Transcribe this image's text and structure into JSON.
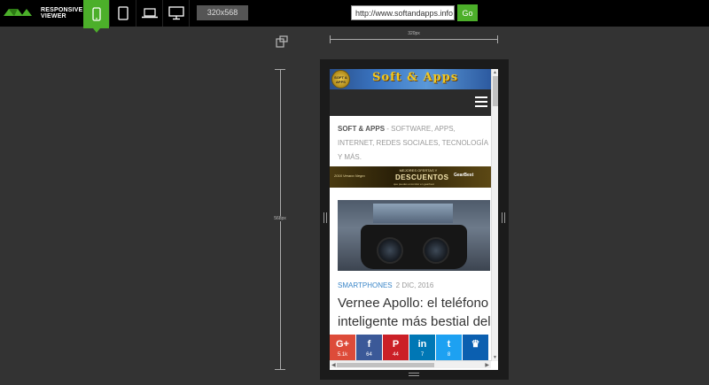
{
  "app": {
    "logo_text_line1": "RESPONSIVE",
    "logo_text_line2": "VIEWER",
    "accent_color": "#4caf2a"
  },
  "toolbar": {
    "devices": [
      {
        "name": "phone",
        "icon": "phone-icon",
        "active": true
      },
      {
        "name": "tablet",
        "icon": "tablet-icon",
        "active": false
      },
      {
        "name": "laptop",
        "icon": "laptop-icon",
        "active": false
      },
      {
        "name": "desktop",
        "icon": "desktop-icon",
        "active": false
      }
    ],
    "size_display": "320x568",
    "url_value": "http://www.softandapps.info",
    "go_label": "Go"
  },
  "rulers": {
    "width_label": "320px",
    "height_label": "568px"
  },
  "site": {
    "banner_logo_text": "SOFT & APPS",
    "banner_title": "Soft & Apps",
    "tagline_bold": "SOFT & APPS",
    "tagline_rest": " - SOFTWARE, APPS, INTERNET, REDES SOCIALES, TECNOLOGÍA Y MÁS.",
    "ad": {
      "left_text": "2016 Verano Negro",
      "title": "MEJORES OFERTAS Y",
      "big": "DESCUENTOS",
      "sub": "que puedes encontrar en gearbest",
      "right_text": "GearBest"
    },
    "article": {
      "category": "SMARTPHONES",
      "date": "2 DIC, 2016",
      "headline": "Vernee Apollo: el teléfono inteligente más bestial del"
    },
    "share": [
      {
        "icon": "G+",
        "count": "5.1k",
        "color": "#dd4b39",
        "name": "google-plus"
      },
      {
        "icon": "f",
        "count": "64",
        "color": "#3b5998",
        "name": "facebook"
      },
      {
        "icon": "P",
        "count": "44",
        "color": "#cb2027",
        "name": "pinterest"
      },
      {
        "icon": "in",
        "count": "7",
        "color": "#0077b5",
        "name": "linkedin"
      },
      {
        "icon": "t",
        "count": "8",
        "color": "#1da1f2",
        "name": "twitter"
      },
      {
        "icon": "♛",
        "count": "",
        "color": "#0b5fb0",
        "name": "sumome"
      }
    ]
  }
}
